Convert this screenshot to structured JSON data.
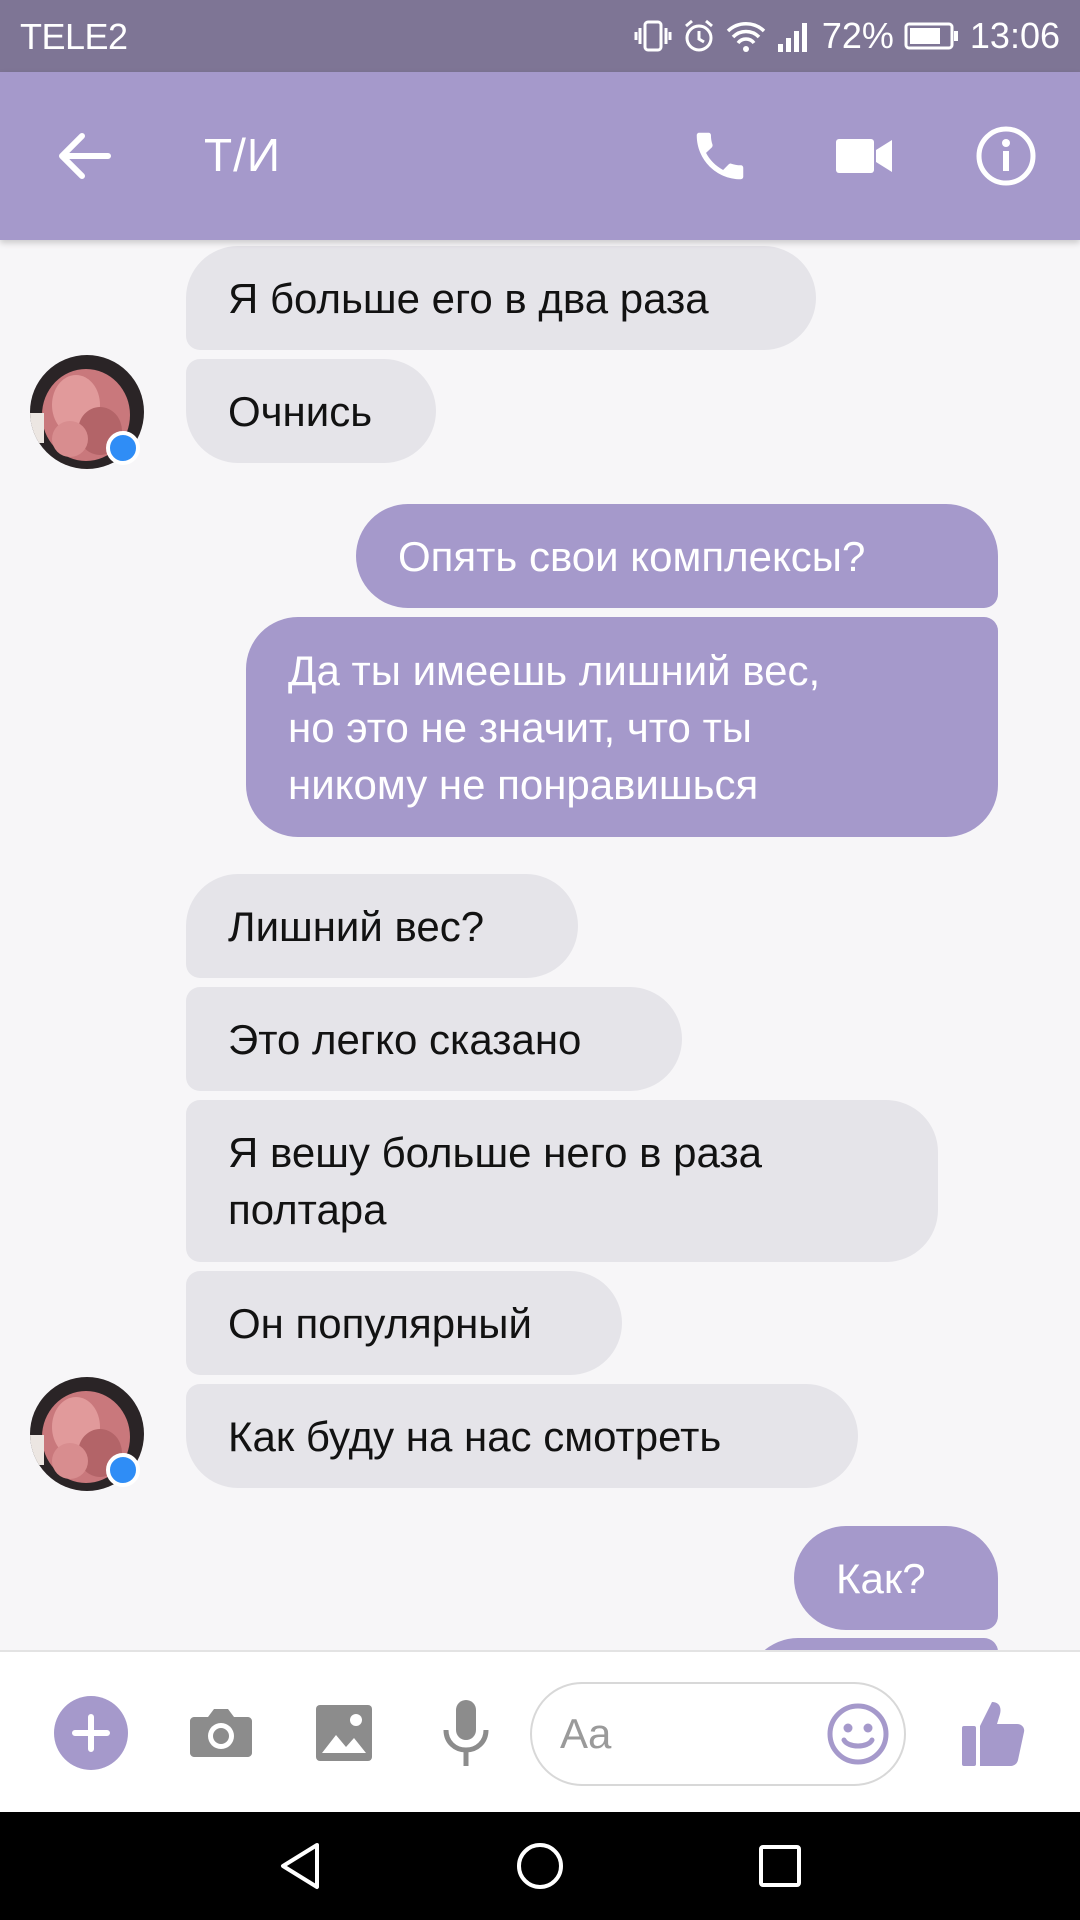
{
  "status_bar": {
    "carrier": "TELE2",
    "battery": "72%",
    "time": "13:06"
  },
  "header": {
    "title": "Т/И"
  },
  "messages": [
    {
      "side": "in",
      "text": "Я больше его в два раза"
    },
    {
      "side": "in",
      "text": "Очнись"
    },
    {
      "side": "out",
      "text": "Опять свои комплексы?"
    },
    {
      "side": "out",
      "text": "Да ты имеешь лишний вес,\nно это не значит, что ты\nникому не понравишься"
    },
    {
      "side": "in",
      "text": "Лишний вес?"
    },
    {
      "side": "in",
      "text": "Это легко сказано"
    },
    {
      "side": "in",
      "text": "Я вешу больше него в раза\nполтара"
    },
    {
      "side": "in",
      "text": "Он популярный"
    },
    {
      "side": "in",
      "text": "Как буду на нас смотреть"
    },
    {
      "side": "out",
      "text": "Как?"
    }
  ],
  "composer": {
    "placeholder": "Aa"
  },
  "colors": {
    "accent": "#a599cb",
    "status_bar": "#7e7595",
    "incoming_bubble": "#e5e4e9",
    "messenger_badge": "#2f8df6"
  },
  "icons": [
    "back-arrow-icon",
    "phone-icon",
    "video-camera-icon",
    "info-icon",
    "plus-icon",
    "camera-icon",
    "image-icon",
    "microphone-icon",
    "emoji-icon",
    "thumbs-up-icon"
  ]
}
